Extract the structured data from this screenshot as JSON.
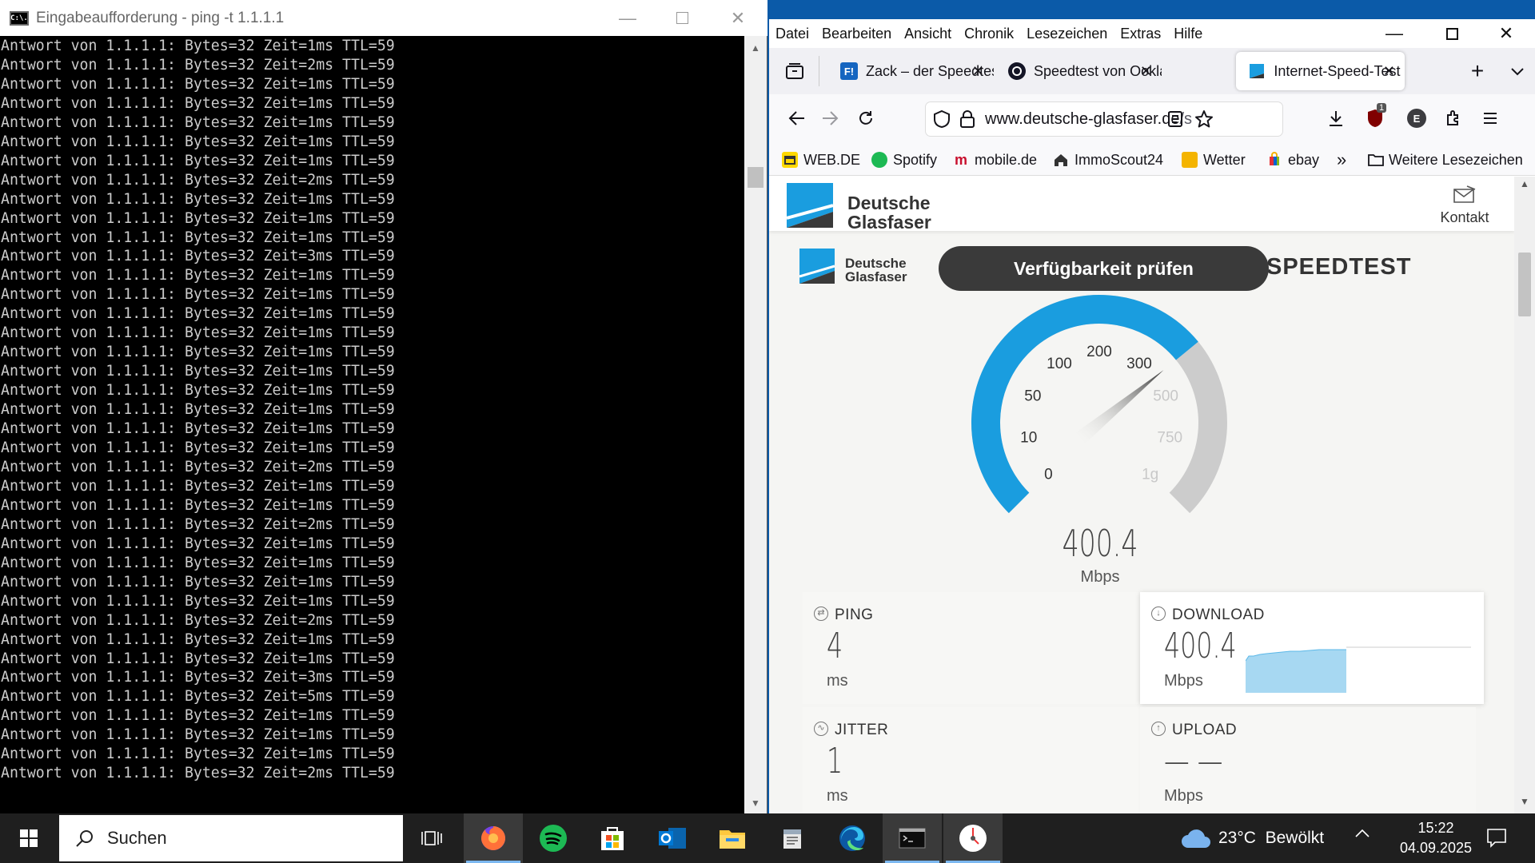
{
  "cmd": {
    "title": "Eingabeaufforderung - ping  -t 1.1.1.1",
    "icon_text": "C:\\.",
    "lines": [
      "Antwort von 1.1.1.1: Bytes=32 Zeit=1ms TTL=59",
      "Antwort von 1.1.1.1: Bytes=32 Zeit=2ms TTL=59",
      "Antwort von 1.1.1.1: Bytes=32 Zeit=1ms TTL=59",
      "Antwort von 1.1.1.1: Bytes=32 Zeit=1ms TTL=59",
      "Antwort von 1.1.1.1: Bytes=32 Zeit=1ms TTL=59",
      "Antwort von 1.1.1.1: Bytes=32 Zeit=1ms TTL=59",
      "Antwort von 1.1.1.1: Bytes=32 Zeit=1ms TTL=59",
      "Antwort von 1.1.1.1: Bytes=32 Zeit=2ms TTL=59",
      "Antwort von 1.1.1.1: Bytes=32 Zeit=1ms TTL=59",
      "Antwort von 1.1.1.1: Bytes=32 Zeit=1ms TTL=59",
      "Antwort von 1.1.1.1: Bytes=32 Zeit=1ms TTL=59",
      "Antwort von 1.1.1.1: Bytes=32 Zeit=3ms TTL=59",
      "Antwort von 1.1.1.1: Bytes=32 Zeit=1ms TTL=59",
      "Antwort von 1.1.1.1: Bytes=32 Zeit=1ms TTL=59",
      "Antwort von 1.1.1.1: Bytes=32 Zeit=1ms TTL=59",
      "Antwort von 1.1.1.1: Bytes=32 Zeit=1ms TTL=59",
      "Antwort von 1.1.1.1: Bytes=32 Zeit=1ms TTL=59",
      "Antwort von 1.1.1.1: Bytes=32 Zeit=1ms TTL=59",
      "Antwort von 1.1.1.1: Bytes=32 Zeit=1ms TTL=59",
      "Antwort von 1.1.1.1: Bytes=32 Zeit=1ms TTL=59",
      "Antwort von 1.1.1.1: Bytes=32 Zeit=1ms TTL=59",
      "Antwort von 1.1.1.1: Bytes=32 Zeit=1ms TTL=59",
      "Antwort von 1.1.1.1: Bytes=32 Zeit=2ms TTL=59",
      "Antwort von 1.1.1.1: Bytes=32 Zeit=1ms TTL=59",
      "Antwort von 1.1.1.1: Bytes=32 Zeit=1ms TTL=59",
      "Antwort von 1.1.1.1: Bytes=32 Zeit=2ms TTL=59",
      "Antwort von 1.1.1.1: Bytes=32 Zeit=1ms TTL=59",
      "Antwort von 1.1.1.1: Bytes=32 Zeit=1ms TTL=59",
      "Antwort von 1.1.1.1: Bytes=32 Zeit=1ms TTL=59",
      "Antwort von 1.1.1.1: Bytes=32 Zeit=1ms TTL=59",
      "Antwort von 1.1.1.1: Bytes=32 Zeit=2ms TTL=59",
      "Antwort von 1.1.1.1: Bytes=32 Zeit=1ms TTL=59",
      "Antwort von 1.1.1.1: Bytes=32 Zeit=1ms TTL=59",
      "Antwort von 1.1.1.1: Bytes=32 Zeit=3ms TTL=59",
      "Antwort von 1.1.1.1: Bytes=32 Zeit=5ms TTL=59",
      "Antwort von 1.1.1.1: Bytes=32 Zeit=1ms TTL=59",
      "Antwort von 1.1.1.1: Bytes=32 Zeit=1ms TTL=59",
      "Antwort von 1.1.1.1: Bytes=32 Zeit=1ms TTL=59",
      "Antwort von 1.1.1.1: Bytes=32 Zeit=2ms TTL=59"
    ]
  },
  "firefox": {
    "menu": [
      "Datei",
      "Bearbeiten",
      "Ansicht",
      "Chronik",
      "Lesezeichen",
      "Extras",
      "Hilfe"
    ],
    "tabs": [
      {
        "label": "Zack – der Speedtest",
        "icon": "f-logo-icon",
        "color": "#1565c0",
        "active": false
      },
      {
        "label": "Speedtest von Ookla",
        "icon": "ookla-icon",
        "color": "#141526",
        "active": false
      },
      {
        "label": "Internet-Speed-Test |",
        "icon": "deutsche-glasfaser-icon",
        "color": "#1a9ddf",
        "active": true
      }
    ],
    "url_host": "www.deutsche-glasfaser.de",
    "url_rest": "/s",
    "ublock_badge": "1",
    "account_initial": "E",
    "bookmarks": [
      {
        "label": "WEB.DE",
        "color": "#ffd800"
      },
      {
        "label": "Spotify",
        "color": "#1db954"
      },
      {
        "label": "mobile.de",
        "color": "#c8102e"
      },
      {
        "label": "ImmoScout24",
        "color": "#333333"
      },
      {
        "label": "Wetter",
        "color": "#f4b400"
      },
      {
        "label": "ebay",
        "color": "#e53238"
      }
    ],
    "bookmarks_more": "»",
    "other_bookmarks": "Weitere Lesezeichen"
  },
  "site": {
    "brand_line1": "Deutsche",
    "brand_line2": "Glasfaser",
    "contact": "Kontakt",
    "availability_button": "Verfügbarkeit prüfen",
    "speedtest_label": "SPEEDTEST",
    "gauge": {
      "labels": [
        "0",
        "10",
        "50",
        "100",
        "200",
        "300",
        "500",
        "750",
        "1g"
      ],
      "value": "400.4",
      "unit": "Mbps",
      "fill_color": "#1a9ddf",
      "track_color": "#cccccc"
    },
    "ping": {
      "label": "PING",
      "value": "4",
      "unit": "ms"
    },
    "download": {
      "label": "DOWNLOAD",
      "value": "400.4",
      "unit": "Mbps"
    },
    "jitter": {
      "label": "JITTER",
      "value": "1",
      "unit": "ms"
    },
    "upload": {
      "label": "UPLOAD",
      "value": "— —",
      "unit": "Mbps"
    }
  },
  "taskbar": {
    "search_placeholder": "Suchen",
    "weather": "23°C  Bewölkt",
    "time": "15:22",
    "date": "04.09.2025"
  }
}
